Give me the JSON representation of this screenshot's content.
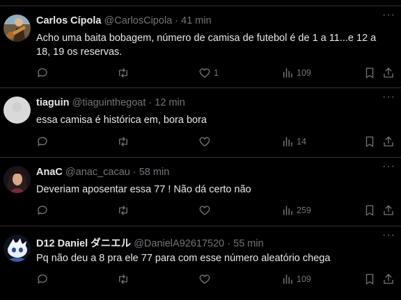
{
  "tweets": [
    {
      "name": "Carlos Cípola",
      "handle": "@CarlosCipola",
      "separator": "·",
      "time": "41 min",
      "text_line1": "Acho uma baita bobagem, número de camisa de futebol é de 1 a 11...e 12 a",
      "text_line2": "18, 19 os reservas.",
      "replies": "",
      "retweets": "",
      "likes": "1",
      "views": "109",
      "avatar": "photo-guitarist"
    },
    {
      "name": "tiaguin",
      "handle": "@tiaguinthegoat",
      "separator": "·",
      "time": "12 min",
      "text_line1": "essa camisa é histórica em, bora bora",
      "text_line2": "",
      "replies": "",
      "retweets": "",
      "likes": "",
      "views": "14",
      "avatar": "default-avatar"
    },
    {
      "name": "AnaC",
      "handle": "@anac_cacau",
      "separator": "·",
      "time": "58 min",
      "text_line1": "Deveriam aposentar essa 77 ! Não dá certo não",
      "text_line2": "",
      "replies": "",
      "retweets": "",
      "likes": "",
      "views": "259",
      "avatar": "photo-woman"
    },
    {
      "name": "D12 Daniel ダニエル",
      "handle": "@DanielA92617520",
      "separator": "·",
      "time": "55 min",
      "text_line1": "Pq não deu a 8 pra ele 77 para com esse número aleatório chega",
      "text_line2": "",
      "replies": "",
      "retweets": "",
      "likes": "",
      "views": "109",
      "avatar": "photo-character"
    }
  ],
  "icons": {
    "more": "more-dots-icon",
    "reply": "reply-icon",
    "retweet": "retweet-icon",
    "like": "heart-icon",
    "views": "views-chart-icon",
    "bookmark": "bookmark-icon",
    "share": "share-icon"
  },
  "colors": {
    "background": "#000000",
    "text": "#e7e9ea",
    "muted": "#71767b",
    "divider": "#2f3336"
  }
}
